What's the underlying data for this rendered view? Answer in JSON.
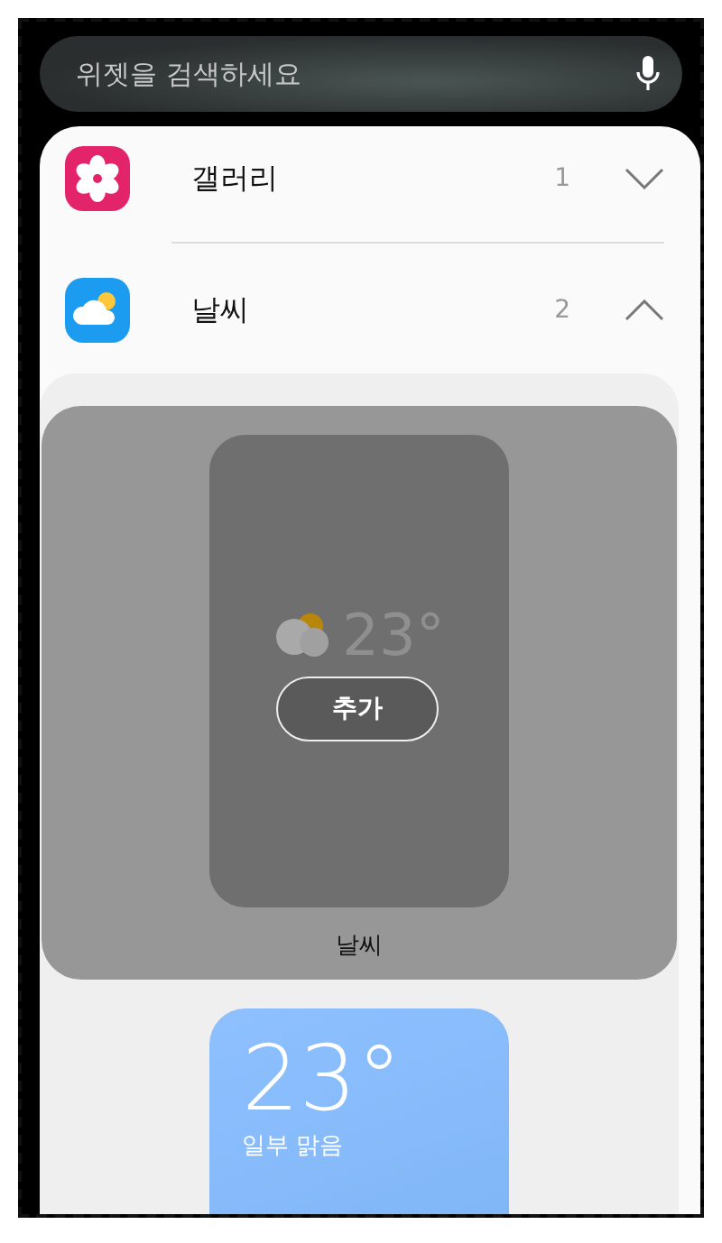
{
  "search": {
    "placeholder": "위젯을 검색하세요"
  },
  "apps": [
    {
      "kind": "gallery",
      "name": "갤러리",
      "count": "1",
      "expanded": false
    },
    {
      "kind": "weather",
      "name": "날씨",
      "count": "2",
      "expanded": true
    }
  ],
  "widgets": [
    {
      "selected": true,
      "temperature": "23°",
      "action": "추가",
      "name": "날씨"
    },
    {
      "selected": false,
      "temperature": "23°",
      "condition": "일부 맑음"
    }
  ]
}
